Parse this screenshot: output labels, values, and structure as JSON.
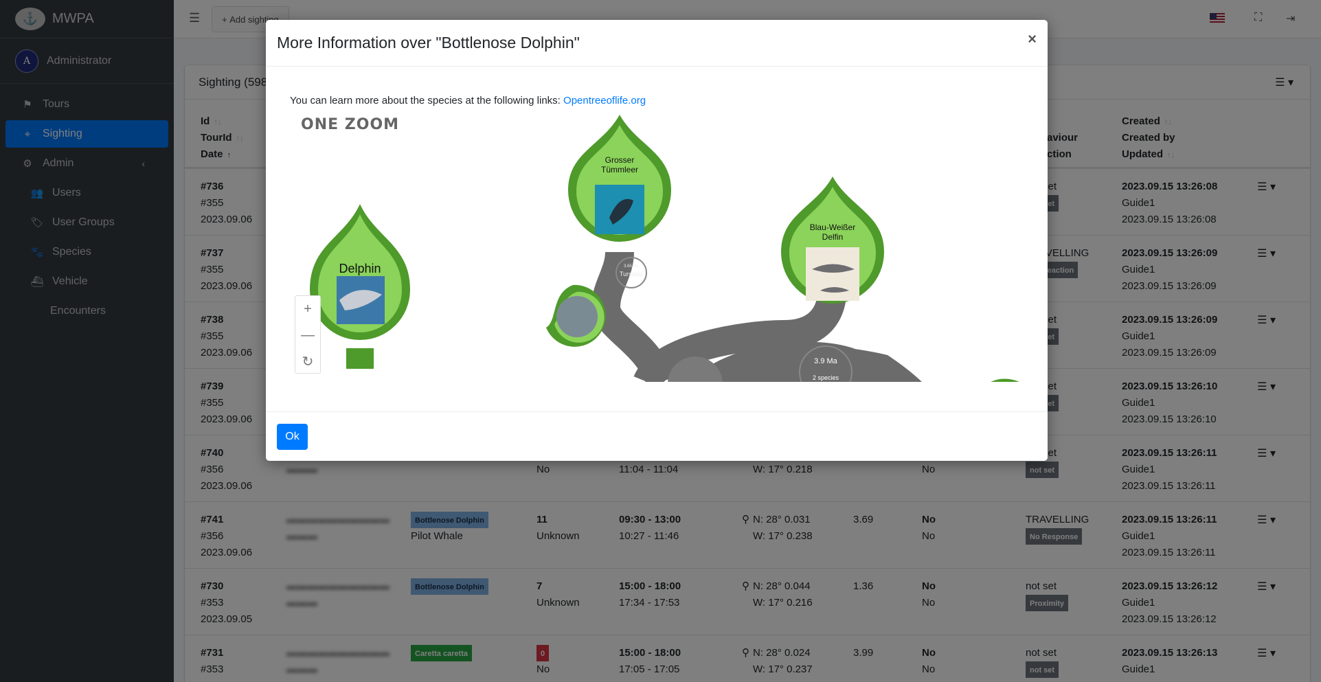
{
  "brand": {
    "name": "MWPA",
    "logo_icon": "whale-tail-icon"
  },
  "user": {
    "initial": "A",
    "name": "Administrator"
  },
  "sidebar": {
    "items": [
      {
        "label": "Tours",
        "icon": "flag-icon"
      },
      {
        "label": "Sighting",
        "icon": "binoculars-icon",
        "active": true
      },
      {
        "label": "Admin",
        "icon": "gears-icon"
      },
      {
        "label": "Users",
        "icon": "users-icon"
      },
      {
        "label": "User Groups",
        "icon": "tags-icon"
      },
      {
        "label": "Species",
        "icon": "paw-icon"
      },
      {
        "label": "Vehicle",
        "icon": "ship-icon"
      },
      {
        "label": "Encounters",
        "icon": ""
      }
    ]
  },
  "topbar": {
    "add_label": "Add sighting"
  },
  "table": {
    "title": "Sighting (598)",
    "headers": {
      "id": "Id",
      "tour": "TourId",
      "date": "Date",
      "behaviour": "aviour",
      "reaction": "ction",
      "created": "Created",
      "created_by": "Created by",
      "updated": "Updated"
    },
    "rows": [
      {
        "id": "#736",
        "tour": "#355",
        "date": "2023.09.06",
        "beh1": "not set",
        "beh2": "not set",
        "created": "2023.09.15 13:26:08",
        "by": "Guide1",
        "updated": "2023.09.15 13:26:08"
      },
      {
        "id": "#737",
        "tour": "#355",
        "date": "2023.09.06",
        "beh1": "TRAVELLING",
        "beh2": "No Reaction",
        "created": "2023.09.15 13:26:09",
        "by": "Guide1",
        "updated": "2023.09.15 13:26:09"
      },
      {
        "id": "#738",
        "tour": "#355",
        "date": "2023.09.06",
        "beh1": "not set",
        "beh2": "not set",
        "created": "2023.09.15 13:26:09",
        "by": "Guide1",
        "updated": "2023.09.15 13:26:09"
      },
      {
        "id": "#739",
        "tour": "#355",
        "date": "2023.09.06",
        "beh1": "not set",
        "beh2": "not set",
        "created": "2023.09.15 13:26:10",
        "by": "Guide1",
        "updated": "2023.09.15 13:26:10"
      },
      {
        "id": "#740",
        "tour": "#356",
        "date": "2023.09.06",
        "count2": "No",
        "time2": "11:04 - 11:04",
        "pos2": "W: 17° 0.218",
        "b2": "No",
        "beh1": "not set",
        "beh2": "not set",
        "created": "2023.09.15 13:26:11",
        "by": "Guide1",
        "updated": "2023.09.15 13:26:11"
      },
      {
        "id": "#741",
        "tour": "#356",
        "date": "2023.09.06",
        "species": "Bottlenose Dolphin",
        "species2": "Pilot Whale",
        "count": "11",
        "count2": "Unknown",
        "time": "09:30 - 13:00",
        "time2": "10:27 - 11:46",
        "pos": "N: 28° 0.031",
        "pos2": "W: 17° 0.238",
        "dist": "3.69",
        "b1": "No",
        "b2": "No",
        "beh1": "TRAVELLING",
        "beh2": "No Response",
        "created": "2023.09.15 13:26:11",
        "by": "Guide1",
        "updated": "2023.09.15 13:26:11"
      },
      {
        "id": "#730",
        "tour": "#353",
        "date": "2023.09.05",
        "species": "Bottlenose Dolphin",
        "count": "7",
        "count2": "Unknown",
        "time": "15:00 - 18:00",
        "time2": "17:34 - 17:53",
        "pos": "N: 28° 0.044",
        "pos2": "W: 17° 0.216",
        "dist": "1.36",
        "b1": "No",
        "b2": "No",
        "beh1": "not set",
        "beh2": "Proximity",
        "created": "2023.09.15 13:26:12",
        "by": "Guide1",
        "updated": "2023.09.15 13:26:12"
      },
      {
        "id": "#731",
        "tour": "#353",
        "date": "2023.09.05",
        "species": "Caretta caretta",
        "count": "0",
        "count2": "No",
        "time": "15:00 - 18:00",
        "time2": "17:05 - 17:05",
        "pos": "N: 28° 0.024",
        "pos2": "W: 17° 0.237",
        "dist": "3.99",
        "b1": "No",
        "b2": "No",
        "beh1": "not set",
        "beh2": "not set",
        "created": "2023.09.15 13:26:13",
        "by": "Guide1",
        "updated": "2023.09.15 13:26:13"
      }
    ]
  },
  "modal": {
    "title": "More Information over \"Bottlenose Dolphin\"",
    "close": "×",
    "intro": "You can learn more about the species at the following links: ",
    "link": "Opentreeoflife.org",
    "ok": "Ok",
    "onezoom": {
      "logo": "ONE ZOOM",
      "leaves": [
        "Delphin",
        "Grosser Tümmleer",
        "Blau-Weißer Delfin"
      ],
      "node_genus": "Tursiops",
      "node_genus_age": "3.65 Ma",
      "node_age": "3.9 Ma",
      "node_species": "2 species"
    }
  },
  "colors": {
    "accent": "#007bff",
    "sidebar": "#343a40",
    "leaf": "#8bd35a",
    "leaf_border": "#4e9a2a",
    "branch": "#6b6b6b"
  }
}
